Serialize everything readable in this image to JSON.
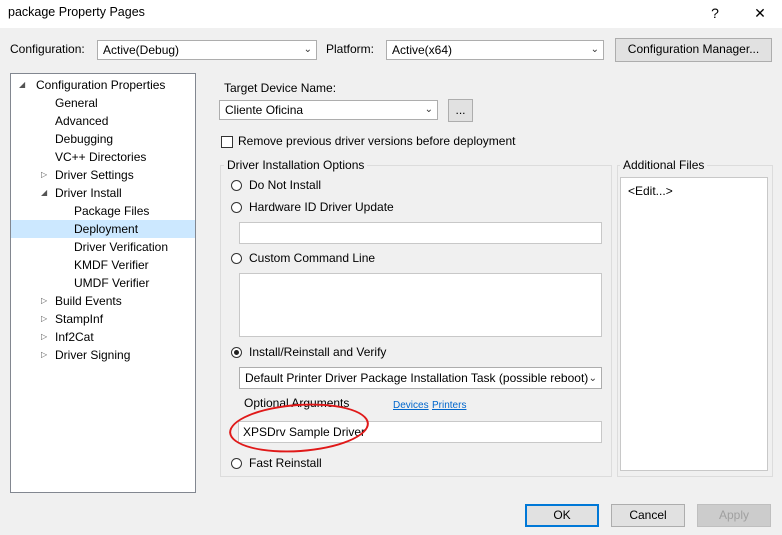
{
  "window": {
    "title": "package Property Pages",
    "help": "?",
    "close": "✕"
  },
  "top": {
    "configuration_label": "Configuration:",
    "configuration_value": "Active(Debug)",
    "platform_label": "Platform:",
    "platform_value": "Active(x64)",
    "config_manager_button": "Configuration Manager..."
  },
  "tree": {
    "root": "Configuration Properties",
    "items": [
      "General",
      "Advanced",
      "Debugging",
      "VC++ Directories",
      "Driver Settings",
      "Driver Install",
      "Package Files",
      "Deployment",
      "Driver Verification",
      "KMDF Verifier",
      "UMDF Verifier",
      "Build Events",
      "StampInf",
      "Inf2Cat",
      "Driver Signing"
    ],
    "selected": "Deployment"
  },
  "main": {
    "target_device_label": "Target Device Name:",
    "target_device_value": "Cliente Oficina",
    "browse_button": "...",
    "remove_previous_label": "Remove previous driver versions before deployment",
    "remove_previous_checked": false,
    "driver_install_group": "Driver Installation Options",
    "do_not_install": "Do Not Install",
    "hardware_id_update": "Hardware ID Driver Update",
    "hardware_id_value": "",
    "custom_command": "Custom Command Line",
    "custom_command_value": "",
    "install_reinstall": "Install/Reinstall and Verify",
    "install_task_value": "Default Printer Driver Package Installation Task (possible reboot)",
    "optional_args_label": "Optional Arguments",
    "devices_link": "Devices",
    "printers_link": "Printers",
    "optional_args_value": "XPSDrv Sample Driver",
    "fast_reinstall": "Fast Reinstall",
    "selected_option": "Install/Reinstall and Verify",
    "additional_files_group": "Additional Files",
    "additional_files_value": "<Edit...>"
  },
  "footer": {
    "ok": "OK",
    "cancel": "Cancel",
    "apply": "Apply"
  },
  "colors": {
    "accent": "#0078d7",
    "selection": "#cce8ff",
    "annotation": "#e01919",
    "link": "#0066cc"
  }
}
